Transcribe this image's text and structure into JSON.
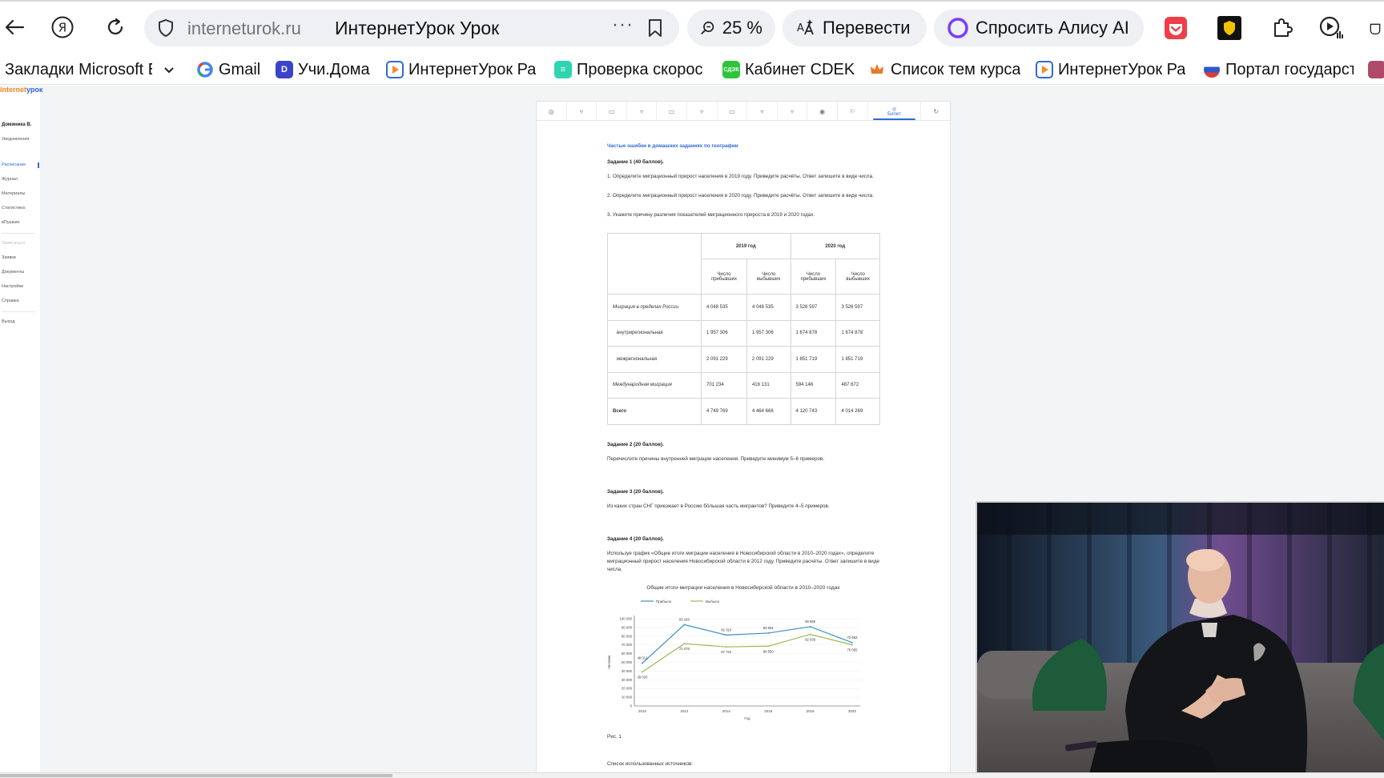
{
  "browser": {
    "domain": "interneturok.ru",
    "tab_title": "ИнтернетУрок Урок",
    "zoom": "25 %",
    "translate_label": "Перевести",
    "ask_alice_label": "Спросить Алису AI"
  },
  "bookmarks": [
    {
      "label": "Закладки Microsoft E",
      "icon": "folder-icon"
    },
    {
      "label": "Gmail",
      "icon": "google-icon"
    },
    {
      "label": "Учи.Дома",
      "icon": "uchi-doma-icon"
    },
    {
      "label": "ИнтернетУрок Ра",
      "icon": "interneturok-icon"
    },
    {
      "label": "Проверка скорос",
      "icon": "speedtest-icon"
    },
    {
      "label": "Кабинет CDEK",
      "icon": "cdek-icon"
    },
    {
      "label": "Список тем курса",
      "icon": "crown-icon"
    },
    {
      "label": "ИнтернетУрок Ра",
      "icon": "interneturok-icon"
    },
    {
      "label": "Портал государст",
      "icon": "gosuslugi-icon"
    }
  ],
  "site": {
    "logo_part1": "internet",
    "logo_part2": "урок",
    "user": "Доминика В.",
    "menu": [
      {
        "label": "Уведомления",
        "state": "normal"
      },
      {
        "label": "Расписание",
        "state": "active"
      },
      {
        "label": "Журнал",
        "state": "normal"
      },
      {
        "label": "Материалы",
        "state": "normal"
      },
      {
        "label": "Статистика",
        "state": "normal"
      },
      {
        "label": "вПушкин",
        "state": "normal"
      },
      {
        "label": "Записаться",
        "state": "muted"
      },
      {
        "label": "Заявки",
        "state": "normal"
      },
      {
        "label": "Документы",
        "state": "normal"
      },
      {
        "label": "Настройки",
        "state": "normal"
      },
      {
        "label": "Справка",
        "state": "normal"
      },
      {
        "label": "Выход",
        "state": "normal"
      }
    ]
  },
  "doc": {
    "active_step_label": "Билет",
    "title": "Частые ошибки в домашних заданиях по географии",
    "task1": {
      "heading": "Задание 1 (40 баллов).",
      "q1": "1. Определите миграционный прирост населения в 2019 году. Приведите расчёты. Ответ запишите в виде числа.",
      "q2": "2. Определите миграционный прирост населения в 2020 году. Приведите расчёты. Ответ запишите в виде числа.",
      "q3": "3. Укажите причину различия показателей миграционного прироста в 2019 и 2020 годах."
    },
    "table": {
      "years": [
        "2019 год",
        "2020 год"
      ],
      "subheaders": [
        "Число прибывших",
        "Число выбывших",
        "Число прибывших",
        "Число выбывших"
      ],
      "rows": [
        {
          "label": "Миграция в пределах России",
          "style": "italic",
          "values": [
            "4 048 535",
            "4 048 535",
            "3 526 597",
            "3 526 597"
          ]
        },
        {
          "label": "внутрирегиональная",
          "style": "indent",
          "values": [
            "1 957 306",
            "1 957 306",
            "1 674 878",
            "1 674 878"
          ]
        },
        {
          "label": "межрегиональная",
          "style": "indent",
          "values": [
            "2 091 229",
            "2 091 229",
            "1 851 719",
            "1 851 719"
          ]
        },
        {
          "label": "Международная миграция",
          "style": "italic",
          "values": [
            "701 234",
            "416 131",
            "594 146",
            "487 672"
          ]
        },
        {
          "label": "Всего",
          "style": "bold",
          "values": [
            "4 749 769",
            "4 464 666",
            "4 120 743",
            "4 014 269"
          ]
        }
      ]
    },
    "task2": {
      "heading": "Задание 2 (20 баллов).",
      "text": "Перечислите причины внутренней миграции населения. Приведите минимум 5–6 примеров."
    },
    "task3": {
      "heading": "Задание 3 (20 баллов).",
      "text": "Из каких стран СНГ приезжает в Россию бо́льшая часть мигрантов? Приведите 4–5 примеров."
    },
    "task4": {
      "heading": "Задание 4 (20 баллов).",
      "text": "Используя график «Общие итоги миграции населения в Новосибирской области в 2010–2020 годах», определите миграционный прирост населения Новосибирской области в 2012 году. Приведите расчёты. Ответ запишите в виде числа."
    },
    "figure_caption": "Рис. 1",
    "sources_heading": "Список использованных источников:"
  },
  "chart_data": {
    "type": "line",
    "title": "Общие итоги миграции населения в Новосибирской области в 2010–2020 годах",
    "xlabel": "Год",
    "ylabel": "Человек",
    "x": [
      2010,
      2012,
      2014,
      2016,
      2018,
      2020
    ],
    "ylim": [
      0,
      100000
    ],
    "yticks": [
      "0",
      "10 000",
      "20 000",
      "30 000",
      "40 000",
      "50 000",
      "60 000",
      "70 000",
      "80 000",
      "90 000",
      "100 000"
    ],
    "legend_position": "top-left",
    "series": [
      {
        "name": "Прибыло",
        "color": "#3a8fc4",
        "values": [
          49012,
          93163,
          81310,
          83534,
          90869,
          72663
        ],
        "labels": [
          "49 012",
          "93 163",
          "81 310",
          "83 534",
          "90 869",
          "72 663"
        ]
      },
      {
        "name": "Выбыло",
        "color": "#9cb84f",
        "values": [
          39033,
          71478,
          67722,
          68550,
          82039,
          70055
        ],
        "labels": [
          "39 033",
          "71 478",
          "67 722",
          "68 550",
          "82 039",
          "70 055"
        ]
      }
    ]
  }
}
